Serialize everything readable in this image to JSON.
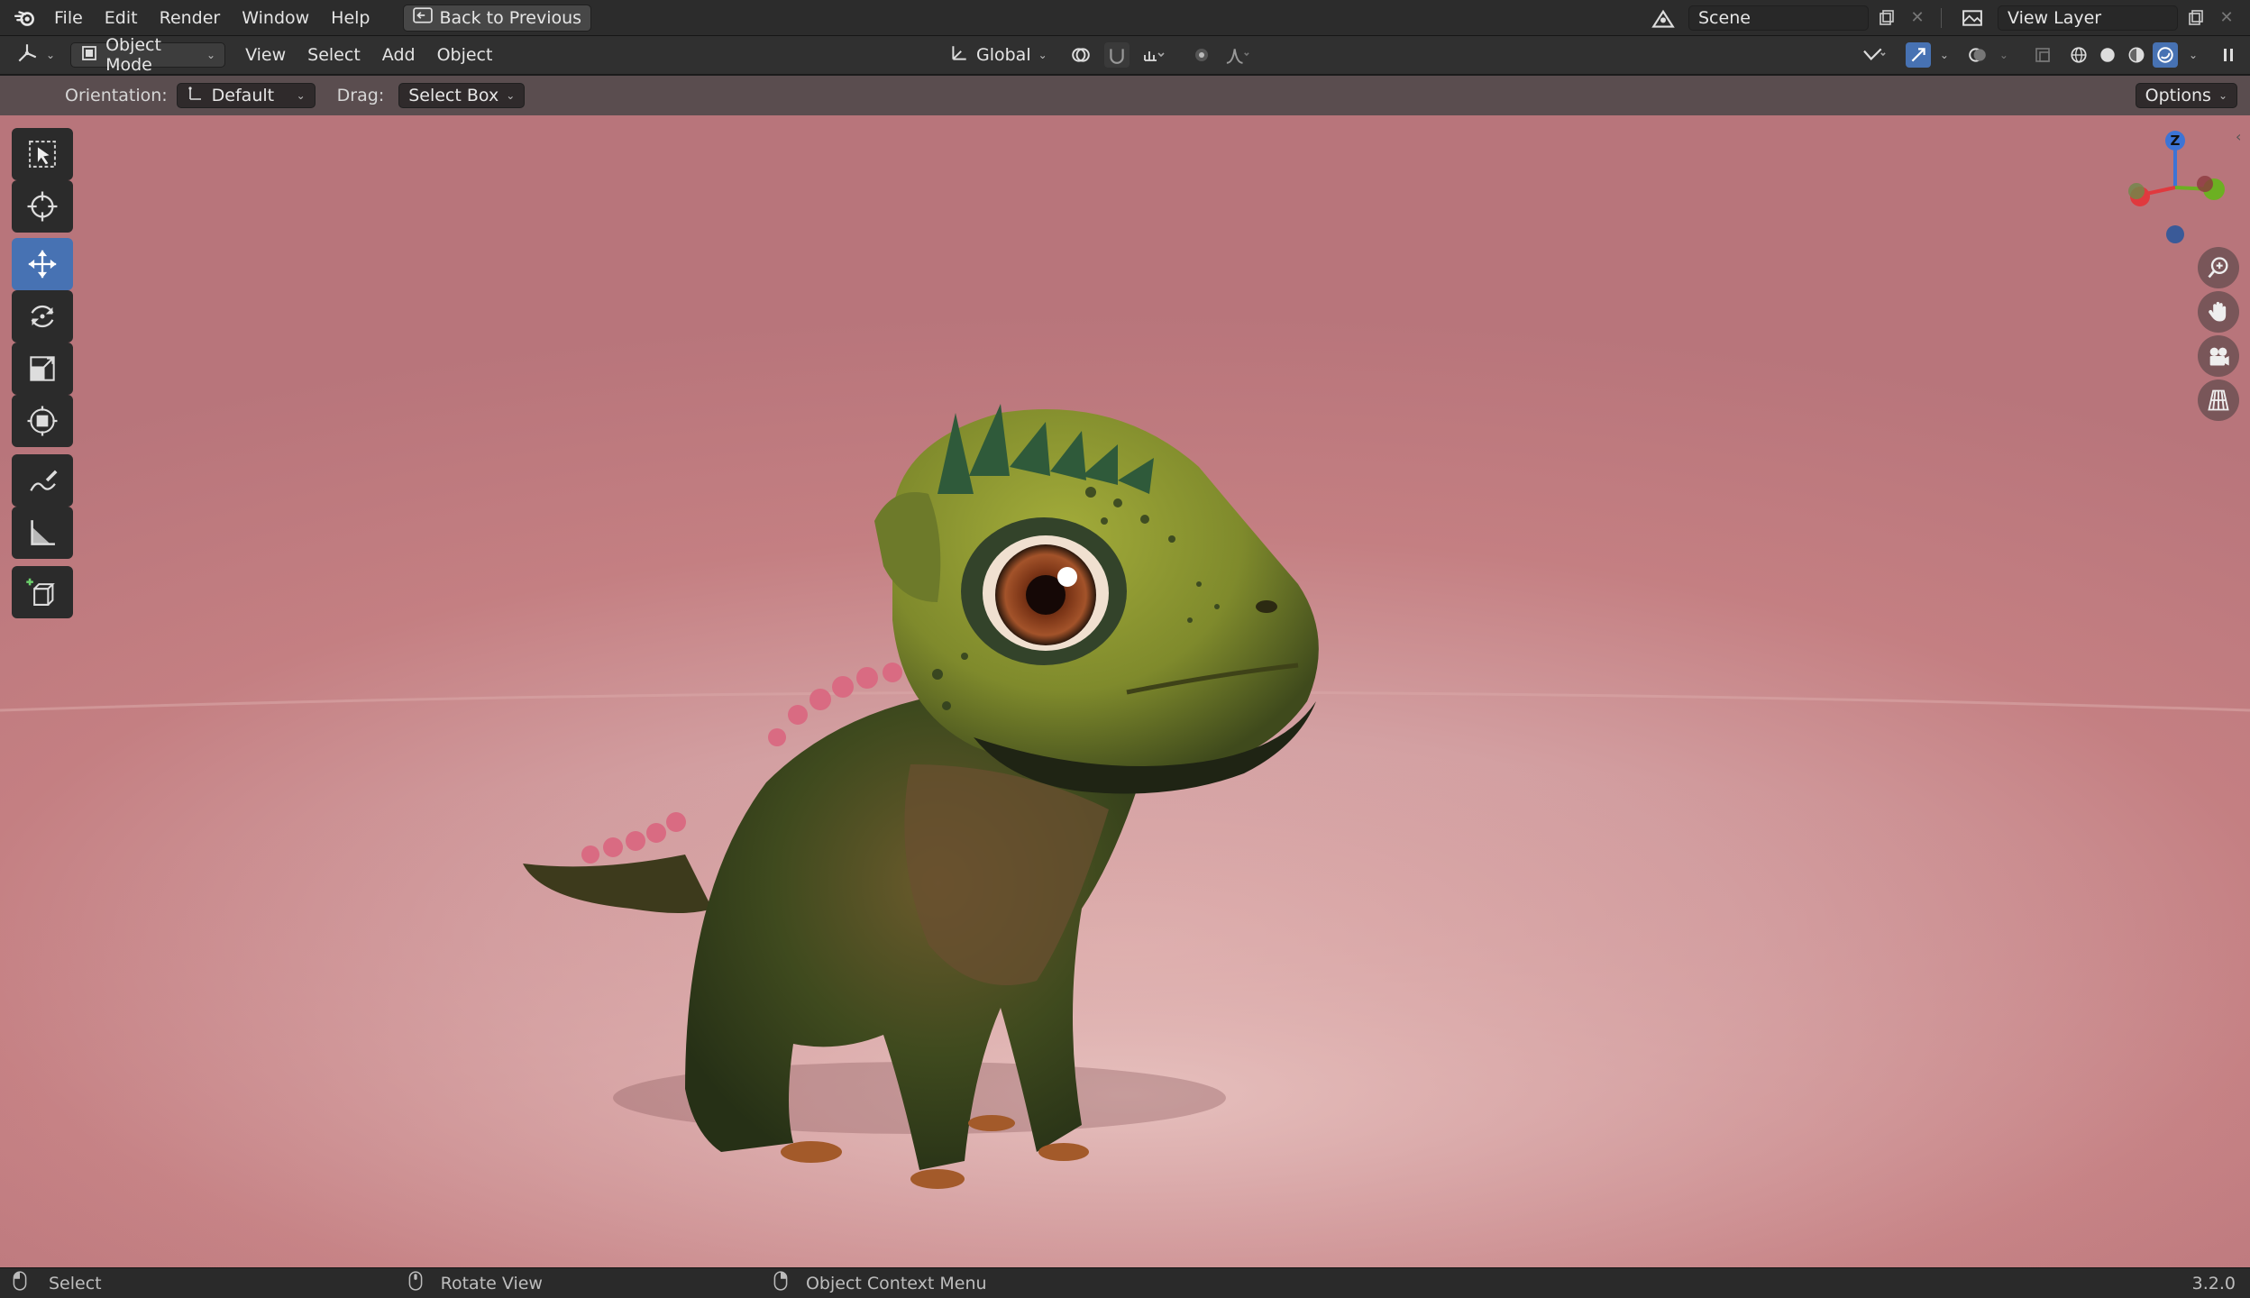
{
  "menubar": {
    "logo_icon": "blender-logo-icon",
    "items": [
      "File",
      "Edit",
      "Render",
      "Window",
      "Help"
    ],
    "back_button": "Back to Previous",
    "scene_label": "Scene",
    "view_layer_label": "View Layer"
  },
  "header": {
    "editor_type_icon": "3d-viewport-icon",
    "mode": "Object Mode",
    "menus": [
      "View",
      "Select",
      "Add",
      "Object"
    ],
    "transform_orientation": "Global"
  },
  "toolsettings": {
    "orientation_label": "Orientation:",
    "orientation_value": "Default",
    "drag_label": "Drag:",
    "drag_value": "Select Box",
    "options_label": "Options"
  },
  "toolbar": {
    "tools": [
      "select-box-icon",
      "cursor-icon",
      "move-icon",
      "rotate-icon",
      "scale-icon",
      "transform-icon",
      "annotate-icon",
      "measure-icon",
      "add-cube-icon"
    ],
    "active_tool": "move-icon"
  },
  "gizmo": {
    "x_label": "",
    "y_label": "",
    "z_label": "Z"
  },
  "statusbar": {
    "left_action": "Select",
    "middle_action": "Rotate View",
    "right_action": "Object Context Menu",
    "version": "3.2.0"
  },
  "colors": {
    "accent": "#4772b3",
    "viewport_bg": "#c98084",
    "axis_x": "#e0393e",
    "axis_y": "#6cb022",
    "axis_z": "#3c74d6"
  }
}
